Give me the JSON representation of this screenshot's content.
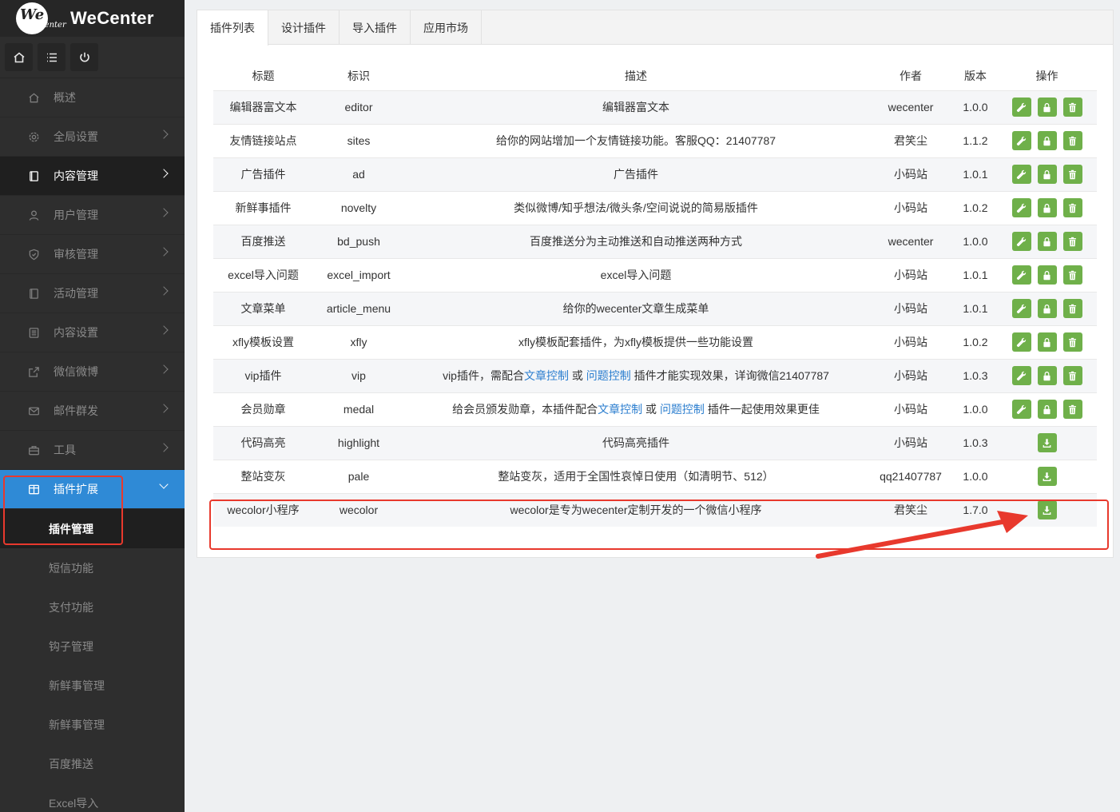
{
  "brand": {
    "logo_we": "We",
    "logo_center": "Center",
    "name": "WeCenter"
  },
  "top_icons": [
    {
      "name": "home-icon"
    },
    {
      "name": "list-icon"
    },
    {
      "name": "power-icon"
    }
  ],
  "sidebar": {
    "items": [
      {
        "label": "概述",
        "icon": "home-icon",
        "chevron": false
      },
      {
        "label": "全局设置",
        "icon": "gear-icon",
        "chevron": true
      },
      {
        "label": "内容管理",
        "icon": "document-icon",
        "chevron": true,
        "state": "dark"
      },
      {
        "label": "用户管理",
        "icon": "user-icon",
        "chevron": true
      },
      {
        "label": "审核管理",
        "icon": "shield-icon",
        "chevron": true
      },
      {
        "label": "活动管理",
        "icon": "document-icon",
        "chevron": true
      },
      {
        "label": "内容设置",
        "icon": "list-doc-icon",
        "chevron": true
      },
      {
        "label": "微信微博",
        "icon": "share-icon",
        "chevron": true
      },
      {
        "label": "邮件群发",
        "icon": "mail-icon",
        "chevron": true
      },
      {
        "label": "工具",
        "icon": "toolbox-icon",
        "chevron": true
      },
      {
        "label": "插件扩展",
        "icon": "window-icon",
        "chevron": true,
        "state": "active"
      }
    ],
    "sub_items": [
      {
        "label": "插件管理",
        "current": true
      },
      {
        "label": "短信功能"
      },
      {
        "label": "支付功能"
      },
      {
        "label": "钩子管理"
      },
      {
        "label": "新鲜事管理"
      },
      {
        "label": "新鲜事管理"
      },
      {
        "label": "百度推送"
      },
      {
        "label": "Excel导入"
      }
    ]
  },
  "tabs": [
    {
      "label": "插件列表",
      "active": true
    },
    {
      "label": "设计插件"
    },
    {
      "label": "导入插件"
    },
    {
      "label": "应用市场"
    }
  ],
  "table": {
    "headers": [
      "标题",
      "标识",
      "描述",
      "作者",
      "版本",
      "操作"
    ],
    "rows": [
      {
        "title": "编辑器富文本",
        "id": "editor",
        "desc": [
          "编辑器富文本"
        ],
        "author": "wecenter",
        "version": "1.0.0",
        "actions": "installed"
      },
      {
        "title": "友情链接站点",
        "id": "sites",
        "desc": [
          "给你的网站增加一个友情链接功能。客服QQ：21407787"
        ],
        "author": "君笑尘",
        "version": "1.1.2",
        "actions": "installed"
      },
      {
        "title": "广告插件",
        "id": "ad",
        "desc": [
          "广告插件"
        ],
        "author": "小码站",
        "version": "1.0.1",
        "actions": "installed"
      },
      {
        "title": "新鲜事插件",
        "id": "novelty",
        "desc": [
          "类似微博/知乎想法/微头条/空间说说的简易版插件"
        ],
        "author": "小码站",
        "version": "1.0.2",
        "actions": "installed"
      },
      {
        "title": "百度推送",
        "id": "bd_push",
        "desc": [
          "百度推送分为主动推送和自动推送两种方式"
        ],
        "author": "wecenter",
        "version": "1.0.0",
        "actions": "installed"
      },
      {
        "title": "excel导入问题",
        "id": "excel_import",
        "desc": [
          "excel导入问题"
        ],
        "author": "小码站",
        "version": "1.0.1",
        "actions": "installed"
      },
      {
        "title": "文章菜单",
        "id": "article_menu",
        "desc": [
          "给你的wecenter文章生成菜单"
        ],
        "author": "小码站",
        "version": "1.0.1",
        "actions": "installed"
      },
      {
        "title": "xfly模板设置",
        "id": "xfly",
        "desc": [
          "xfly模板配套插件，为xfly模板提供一些功能设置"
        ],
        "author": "小码站",
        "version": "1.0.2",
        "actions": "installed"
      },
      {
        "title": "vip插件",
        "id": "vip",
        "desc": [
          "vip插件，需配合",
          {
            "link": "文章控制"
          },
          " 或 ",
          {
            "link": "问题控制"
          },
          " 插件才能实现效果，详询微信21407787"
        ],
        "author": "小码站",
        "version": "1.0.3",
        "actions": "installed"
      },
      {
        "title": "会员勋章",
        "id": "medal",
        "desc": [
          "给会员颁发勋章，本插件配合",
          {
            "link": "文章控制"
          },
          " 或 ",
          {
            "link": "问题控制"
          },
          " 插件一起使用效果更佳"
        ],
        "author": "小码站",
        "version": "1.0.0",
        "actions": "installed"
      },
      {
        "title": "代码高亮",
        "id": "highlight",
        "desc": [
          "代码高亮插件"
        ],
        "author": "小码站",
        "version": "1.0.3",
        "actions": "install"
      },
      {
        "title": "整站变灰",
        "id": "pale",
        "desc": [
          "整站变灰，适用于全国性哀悼日使用（如清明节、512）"
        ],
        "author": "qq21407787",
        "version": "1.0.0",
        "actions": "install"
      },
      {
        "title": "wecolor小程序",
        "id": "wecolor",
        "desc": [
          "wecolor是专为wecenter定制开发的一个微信小程序"
        ],
        "author": "君笑尘",
        "version": "1.7.0",
        "actions": "install"
      }
    ]
  },
  "colors": {
    "sidebar": "#2e2e2e",
    "active": "#2f8ad6",
    "action_green": "#6fb04a",
    "annotation_red": "#e8392d",
    "link": "#2b7ecf"
  }
}
